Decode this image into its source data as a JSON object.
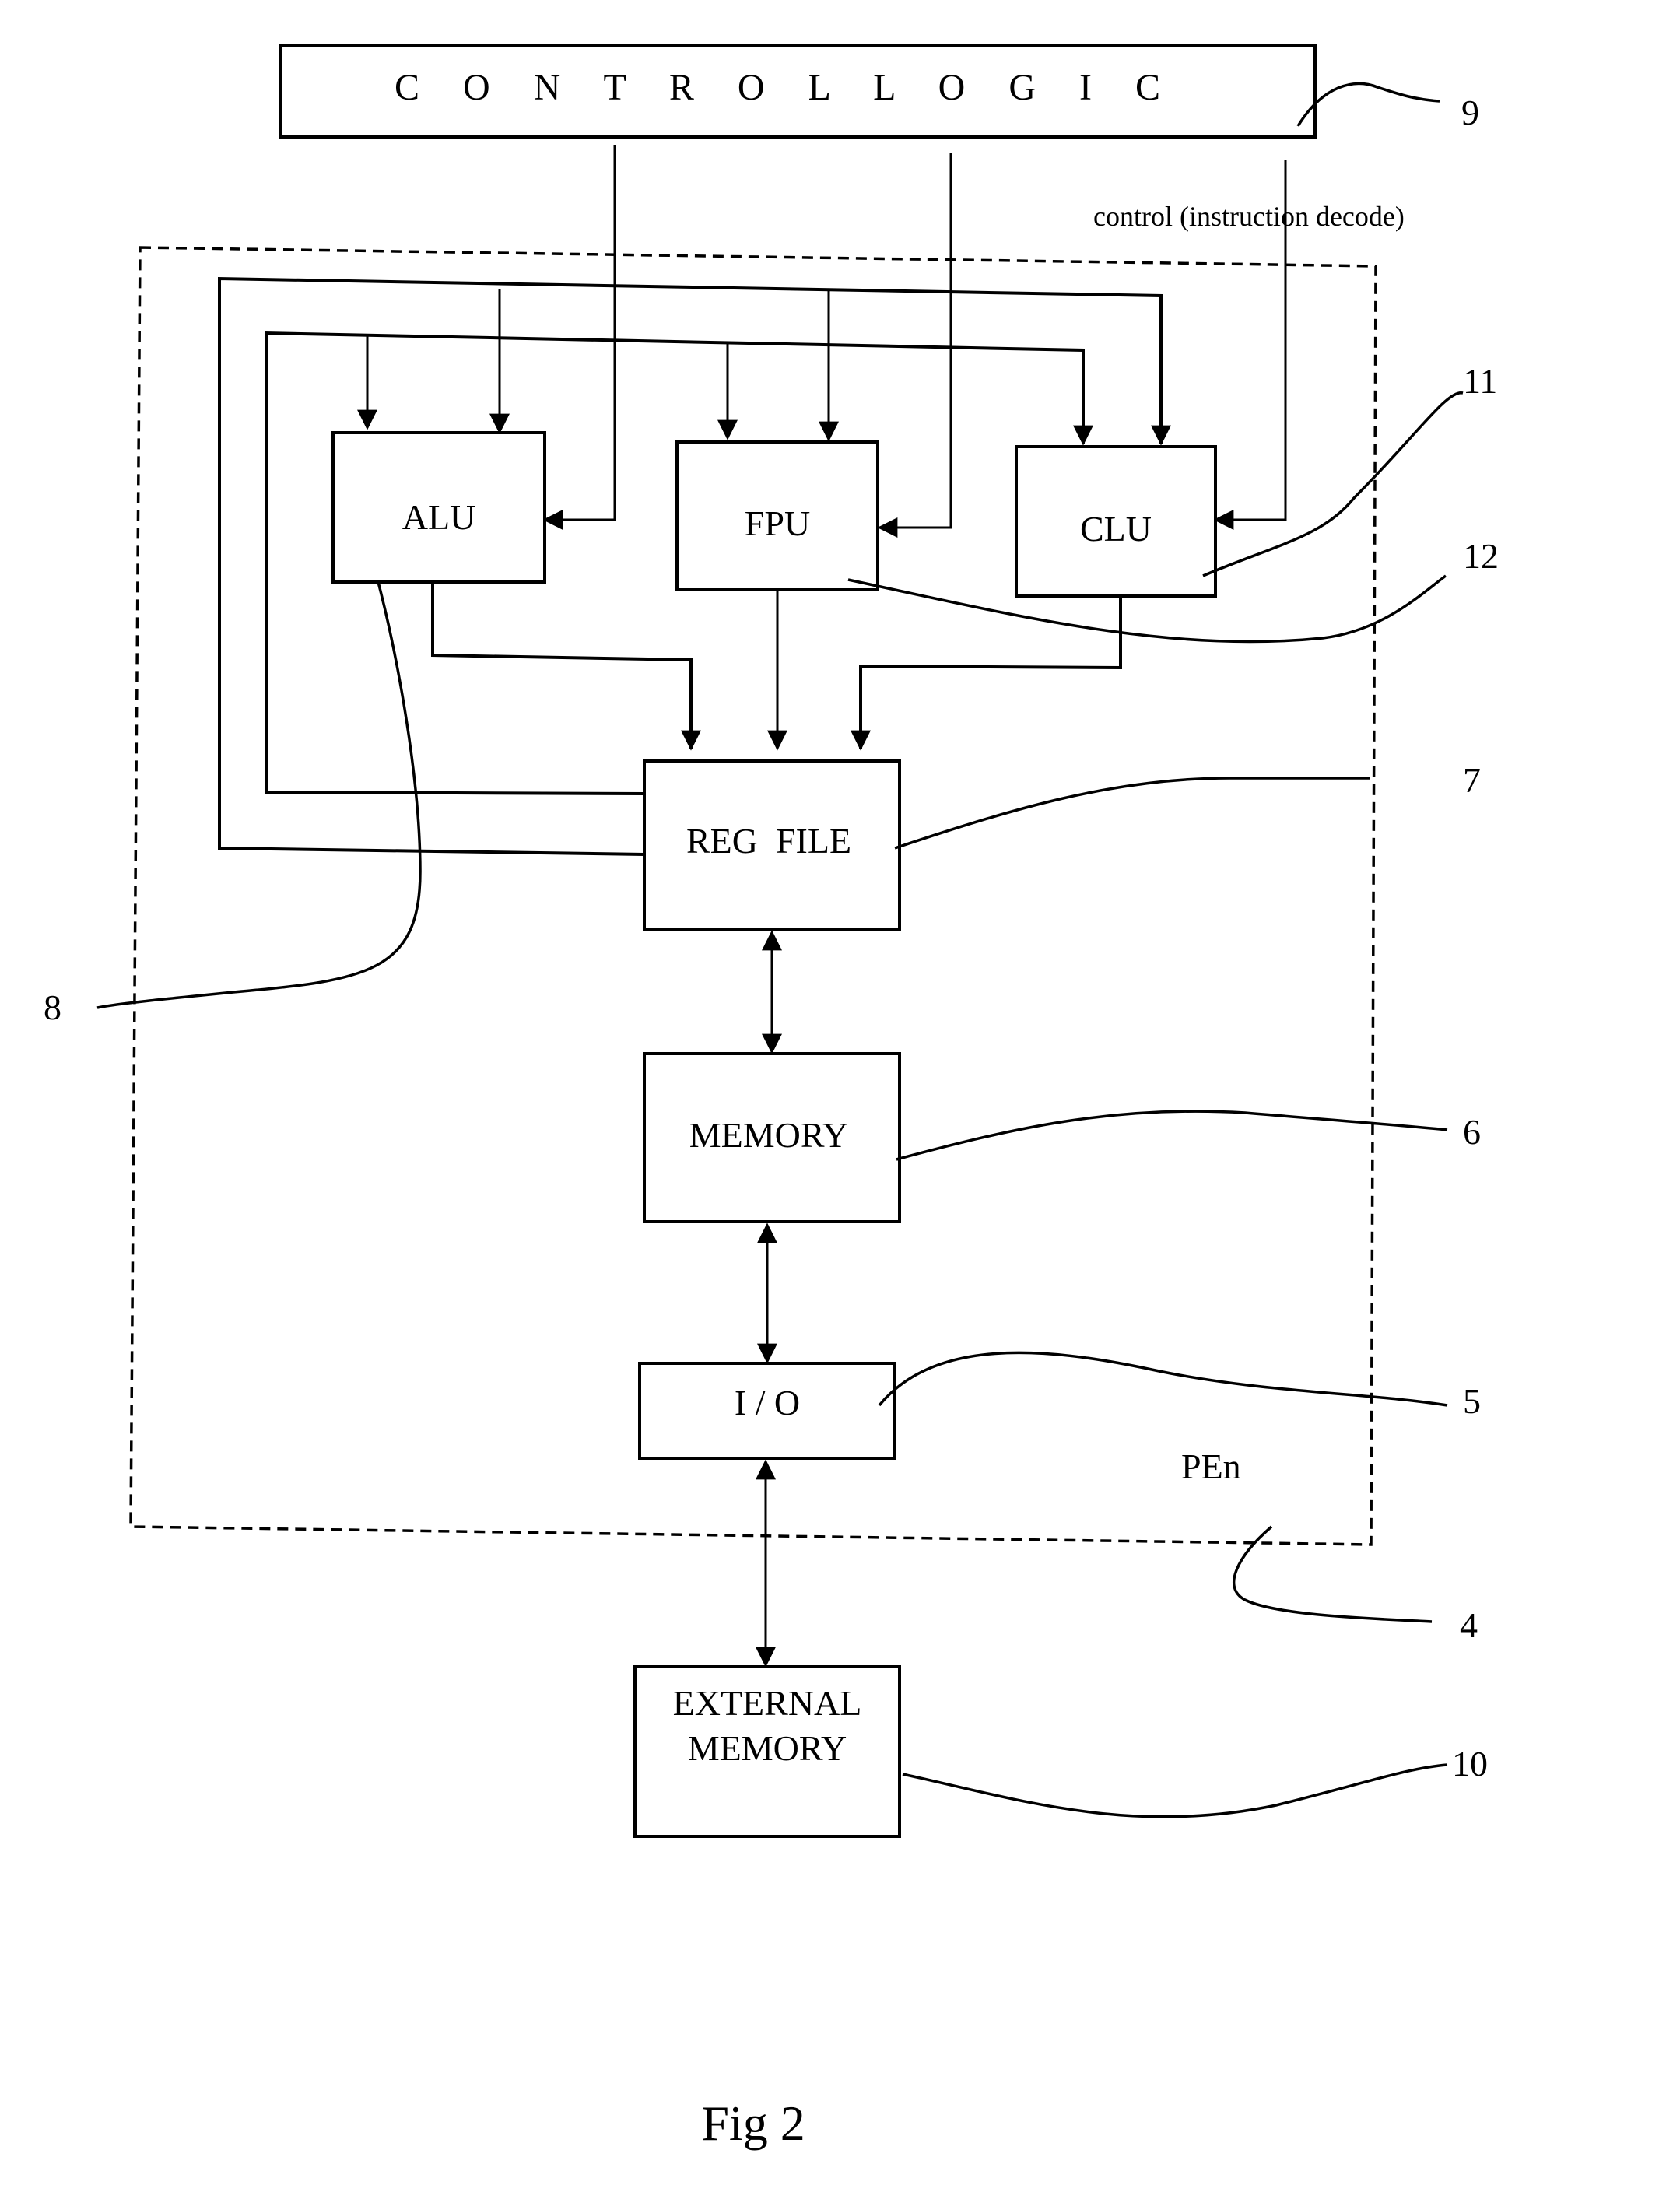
{
  "figure": {
    "caption": "Fig 2",
    "enclosure_label": "PEn",
    "control_note": "control (instruction decode)"
  },
  "blocks": {
    "control_logic": "C O N T R O L     L O G I C",
    "alu": "ALU",
    "fpu": "FPU",
    "clu": "CLU",
    "reg_file": "REG  FILE",
    "memory": "MEMORY",
    "io": "I / O",
    "external_memory_line1": "EXTERNAL",
    "external_memory_line2": "MEMORY"
  },
  "references": {
    "control_logic": "9",
    "clu": "11",
    "fpu": "12",
    "reg_file": "7",
    "alu": "8",
    "memory": "6",
    "io": "5",
    "pe_boundary": "4",
    "external_memory": "10"
  }
}
